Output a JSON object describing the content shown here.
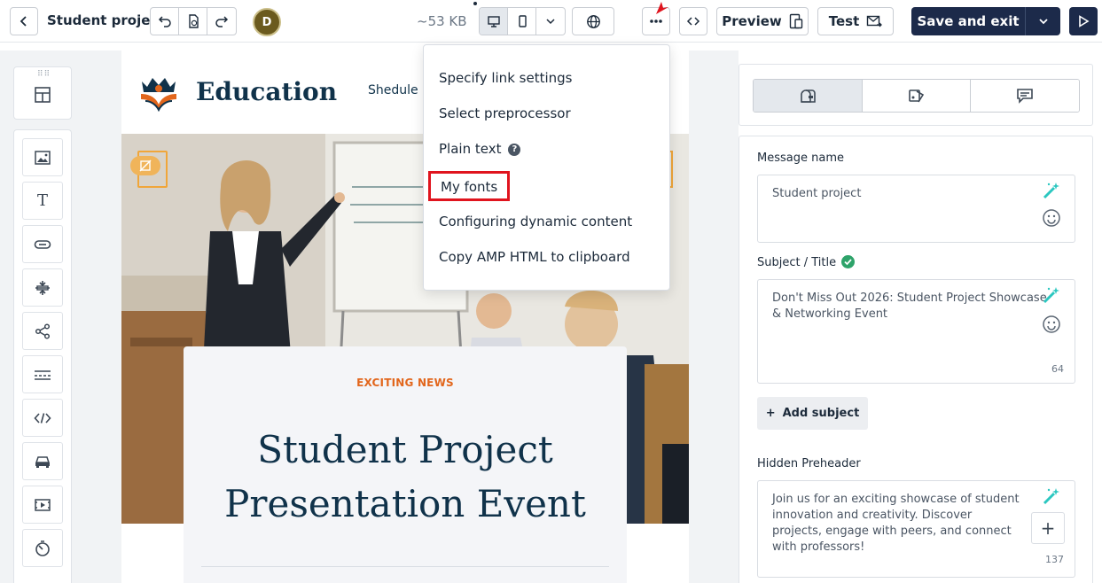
{
  "header": {
    "project_title": "Student project",
    "avatar_initial": "D",
    "size": "~53 KB",
    "preview_label": "Preview",
    "test_label": "Test",
    "save_label": "Save and exit"
  },
  "menu": {
    "items": [
      "Specify link settings",
      "Select preprocessor",
      "Plain text",
      "My fonts",
      "Configuring dynamic content",
      "Copy AMP HTML to clipboard"
    ],
    "highlighted": "My fonts"
  },
  "email": {
    "brand": "Education",
    "nav_link": "Shedule",
    "kicker": "EXCITING NEWS",
    "headline": "Student Project Presentation Event"
  },
  "settings": {
    "message_name_label": "Message name",
    "message_name_value": "Student project",
    "subject_label": "Subject / Title",
    "subject_value": "Don't Miss Out 2026: Student Project Showcase & Networking Event",
    "subject_count": "64",
    "add_subject_label": "Add subject",
    "preheader_label": "Hidden Preheader",
    "preheader_value": "Join us for an exciting showcase of student innovation and creativity. Discover projects, engage with peers, and connect with professors!",
    "preheader_count": "137"
  },
  "colors": {
    "accent_dark": "#1c2a4a",
    "brand_orange": "#e2661c",
    "highlight_red": "#e0141e",
    "success_green": "#2ea36a"
  }
}
